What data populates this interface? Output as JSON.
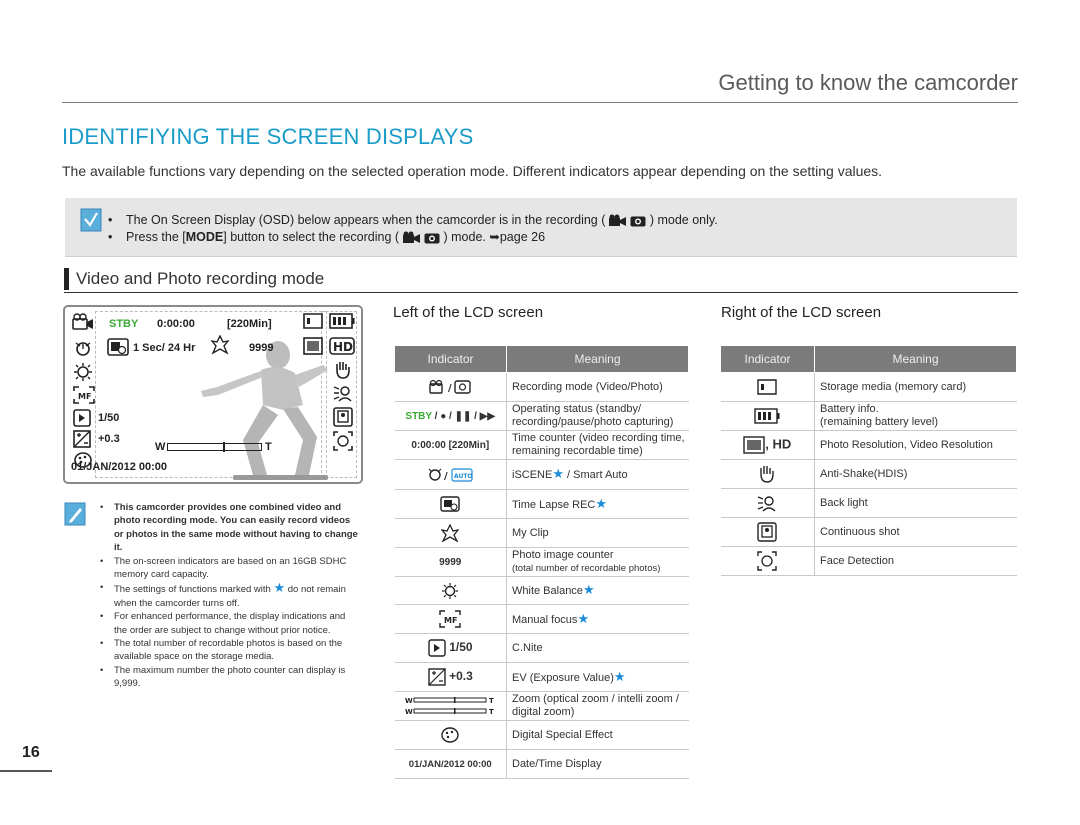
{
  "chapter": "Getting to know the camcorder",
  "title": "IDENTIFIYING THE SCREEN DISPLAYS",
  "intro": "The available functions vary depending on the selected operation mode. Different indicators appear depending on the setting values.",
  "note": {
    "line1_a": "The On Screen Display (OSD) below appears when the camcorder is in the recording (",
    "line1_b": ") mode only.",
    "line2_a": "Press the [",
    "line2_bold": "MODE",
    "line2_b": "] button to select the recording (",
    "line2_c": ") mode. ",
    "line2_ref": "page 26"
  },
  "section": "Video and Photo recording mode",
  "lcd": {
    "stby": "STBY",
    "time": "0:00:00",
    "remain": "[220Min]",
    "interval": "1 Sec/ 24 Hr",
    "counter": "9999",
    "cnite": "1/50",
    "ev": "+0.3",
    "zoom_w": "W",
    "zoom_t": "T",
    "date": "01/JAN/2012 00:00"
  },
  "side_notes": [
    {
      "text": "This camcorder provides one combined video and photo recording mode. You can easily record videos or photos in the same mode without having to change it.",
      "bold": true
    },
    {
      "text": "The on-screen indicators are based on an 16GB SDHC memory card capacity.",
      "bold": false
    },
    {
      "text_a": "The settings of functions marked with ",
      "text_b": " do not remain when the camcorder turns off.",
      "bold": false
    },
    {
      "text": "For enhanced performance, the display indications and the order are subject to change without prior notice.",
      "bold": false
    },
    {
      "text": "The total number of recordable photos is based on the available space on the storage media.",
      "bold": false
    },
    {
      "text": "The maximum number the photo counter can display is 9,999.",
      "bold": false
    }
  ],
  "page_number": "16",
  "left_table": {
    "heading": "Left of the LCD screen",
    "col_indicator": "Indicator",
    "col_meaning": "Meaning",
    "rows": [
      {
        "meaning": "Recording mode (Video/Photo)"
      },
      {
        "meaning": "Operating status (standby/ recording/pause/photo capturing)"
      },
      {
        "ind_text": "0:00:00 [220Min]",
        "meaning": "Time counter (video recording time, remaining recordable time)"
      },
      {
        "meaning_a": "iSCENE",
        "meaning_b": " / Smart Auto"
      },
      {
        "meaning": "Time Lapse REC"
      },
      {
        "meaning": "My Clip"
      },
      {
        "ind_text": "9999",
        "meaning": "Photo image counter",
        "meaning_small": "(total number of recordable photos)"
      },
      {
        "meaning": "White Balance"
      },
      {
        "meaning": "Manual focus"
      },
      {
        "ind_text": "1/50",
        "meaning": "C.Nite"
      },
      {
        "ind_text": "+0.3",
        "meaning": "EV (Exposure Value)"
      },
      {
        "meaning": "Zoom (optical zoom / intelli zoom / digital zoom)"
      },
      {
        "meaning": "Digital Special Effect"
      },
      {
        "ind_text": "01/JAN/2012 00:00",
        "meaning": "Date/Time Display"
      }
    ]
  },
  "right_table": {
    "heading": "Right of the LCD screen",
    "col_indicator": "Indicator",
    "col_meaning": "Meaning",
    "rows": [
      {
        "meaning": "Storage media (memory card)"
      },
      {
        "meaning": "Battery info.",
        "meaning_small": "(remaining battery level)"
      },
      {
        "ind_text": ", HD",
        "meaning": "Photo Resolution, Video Resolution"
      },
      {
        "meaning": "Anti-Shake(HDIS)"
      },
      {
        "meaning": "Back light"
      },
      {
        "meaning": "Continuous shot"
      },
      {
        "meaning": "Face Detection"
      }
    ]
  },
  "colors": {
    "accent": "#1a9cc8",
    "star": "#1a8cd8",
    "stby_green": "#3aa935",
    "table_header": "#7b7b7b"
  }
}
